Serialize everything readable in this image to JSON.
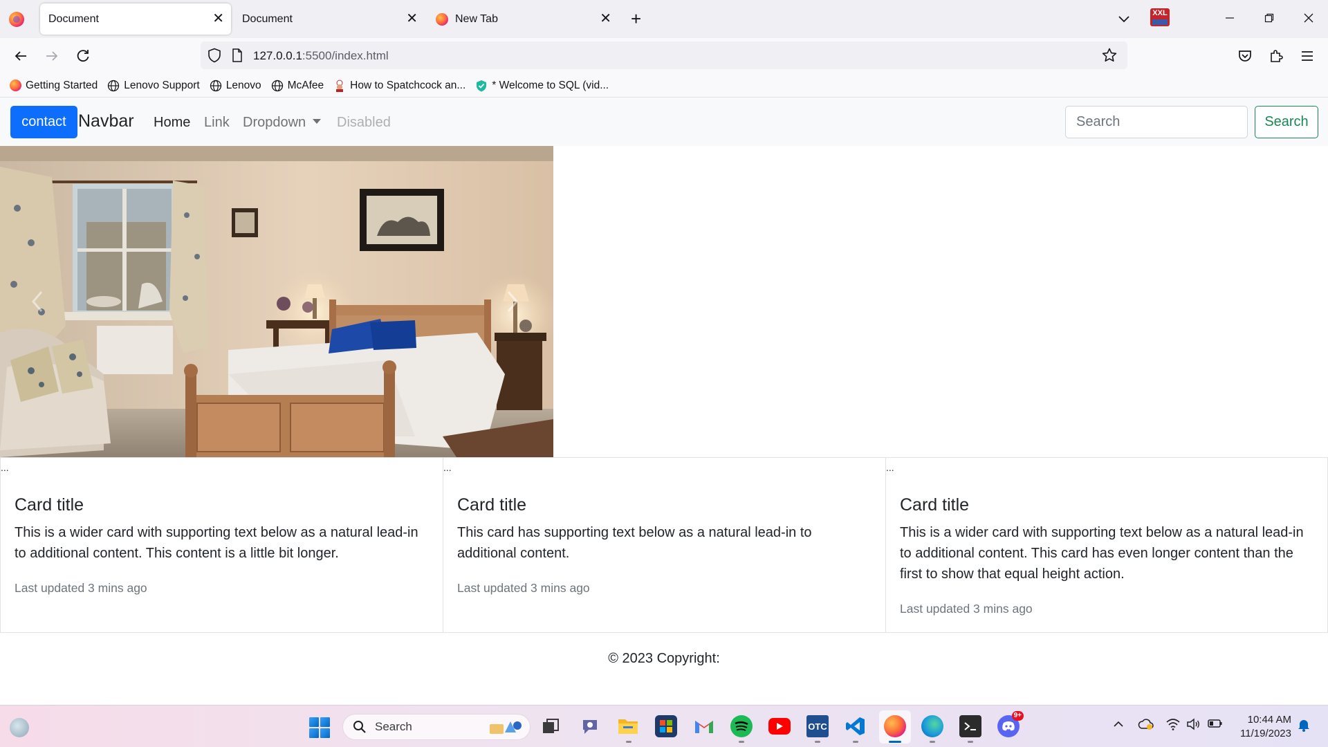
{
  "browser": {
    "tabs": [
      {
        "title": "Document",
        "active": true
      },
      {
        "title": "Document",
        "active": false
      },
      {
        "title": "New Tab",
        "active": false
      }
    ],
    "extension_badge": "XXL",
    "url": {
      "host": "127.0.0.1",
      "path": ":5500/index.html"
    },
    "bookmarks": [
      {
        "label": "Getting Started",
        "icon": "firefox-icon"
      },
      {
        "label": "Lenovo Support",
        "icon": "globe-icon"
      },
      {
        "label": "Lenovo",
        "icon": "globe-icon"
      },
      {
        "label": "McAfee",
        "icon": "globe-icon"
      },
      {
        "label": "How to Spatchcock an...",
        "icon": "chef-icon"
      },
      {
        "label": "* Welcome to SQL (vid...",
        "icon": "shield-check-icon"
      }
    ]
  },
  "site": {
    "contact_label": "contact",
    "brand": "Navbar",
    "nav": {
      "home": "Home",
      "link": "Link",
      "dropdown": "Dropdown",
      "disabled": "Disabled"
    },
    "search": {
      "placeholder": "Search",
      "button": "Search"
    },
    "cards": [
      {
        "img_alt": "...",
        "title": "Card title",
        "text": "This is a wider card with supporting text below as a natural lead-in to additional content. This content is a little bit longer.",
        "updated": "Last updated 3 mins ago"
      },
      {
        "img_alt": "...",
        "title": "Card title",
        "text": "This card has supporting text below as a natural lead-in to additional content.",
        "updated": "Last updated 3 mins ago"
      },
      {
        "img_alt": "...",
        "title": "Card title",
        "text": "This is a wider card with supporting text below as a natural lead-in to additional content. This card has even longer content than the first to show that equal height action.",
        "updated": "Last updated 3 mins ago"
      }
    ],
    "footer": "© 2023 Copyright:"
  },
  "taskbar": {
    "search_label": "Search",
    "apps": [
      "file-explorer-icon",
      "task-view-icon",
      "teams-icon",
      "folder-icon",
      "store-icon",
      "gmail-icon",
      "spotify-icon",
      "youtube-icon",
      "otc-icon",
      "vscode-icon",
      "firefox-icon",
      "edge-icon",
      "terminal-icon",
      "discord-icon"
    ],
    "otc_label": "OTC",
    "discord_badge": "9+",
    "time": "10:44 AM",
    "date": "11/19/2023"
  },
  "colors": {
    "primary": "#0d6efd",
    "success": "#198754",
    "nav_bg": "#f8f9fa",
    "muted": "#6c757d"
  }
}
